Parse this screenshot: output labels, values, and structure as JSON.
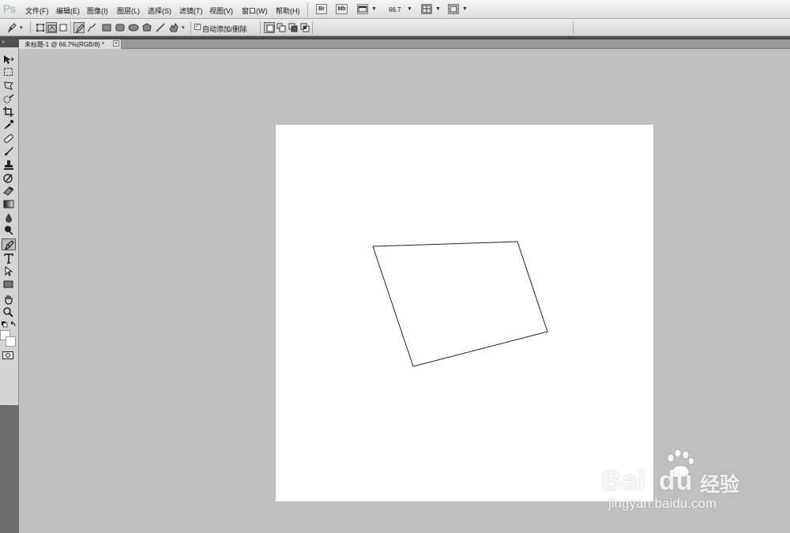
{
  "app": {
    "logo": "Ps"
  },
  "menu": [
    {
      "label": "文件(F)"
    },
    {
      "label": "编辑(E)"
    },
    {
      "label": "图像(I)"
    },
    {
      "label": "图层(L)"
    },
    {
      "label": "选择(S)"
    },
    {
      "label": "滤镜(T)"
    },
    {
      "label": "视图(V)"
    },
    {
      "label": "窗口(W)"
    },
    {
      "label": "帮助(H)"
    }
  ],
  "appbar": {
    "bridge_label": "Br",
    "minibridge_label": "Mb",
    "zoom": "66.7"
  },
  "options": {
    "auto_add_checked": true,
    "auto_add_label": "自动添加/删除"
  },
  "document": {
    "tab_title": "未标题-1 @ 66.7%(RGB/8) *",
    "close_glyph": "×"
  },
  "tools": [
    "move-tool",
    "marquee-tool",
    "lasso-tool",
    "quick-selection-tool",
    "crop-tool",
    "eyedropper-tool",
    "spot-healing-tool",
    "brush-tool",
    "clone-stamp-tool",
    "history-brush-tool",
    "eraser-tool",
    "gradient-tool",
    "blur-tool",
    "dodge-tool",
    "pen-tool",
    "type-tool",
    "path-selection-tool",
    "rectangle-tool",
    "hand-tool",
    "zoom-tool"
  ],
  "active_tool": "pen-tool",
  "watermark": {
    "brand": "Bai",
    "brand_du": "du",
    "cn": "经验",
    "url": "jingyan.baidu.com"
  },
  "colors": {
    "ui_bg": "#c0c0c0",
    "canvas": "#ffffff",
    "toolbox": "#d4d4d4"
  }
}
